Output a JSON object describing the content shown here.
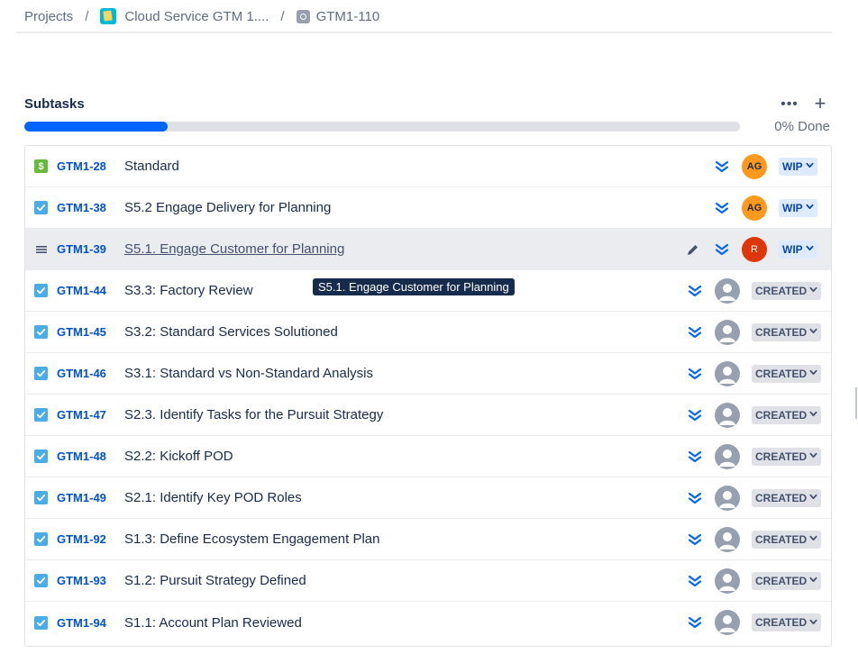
{
  "breadcrumb": {
    "projects": "Projects",
    "project": "Cloud Service GTM 1....",
    "issue": "GTM1-110"
  },
  "subtasks": {
    "title": "Subtasks",
    "progress_percent": 20,
    "done_label": "0% Done",
    "more_icon": "more-icon",
    "add_icon": "plus-icon"
  },
  "tooltip": "S5.1. Engage Customer for Planning",
  "rows": [
    {
      "type": "money",
      "key": "GTM1-28",
      "summary": "Standard",
      "avatar": "AG",
      "status": "WIP"
    },
    {
      "type": "task",
      "key": "GTM1-38",
      "summary": "S5.2 Engage Delivery for Planning",
      "avatar": "AG",
      "status": "WIP"
    },
    {
      "type": "menu",
      "key": "GTM1-39",
      "summary": "S5.1. Engage Customer for Planning",
      "avatar": "R",
      "status": "WIP"
    },
    {
      "type": "task",
      "key": "GTM1-44",
      "summary": "S3.3: Factory Review",
      "avatar": "",
      "status": "CREATED"
    },
    {
      "type": "task",
      "key": "GTM1-45",
      "summary": "S3.2: Standard Services Solutioned",
      "avatar": "",
      "status": "CREATED"
    },
    {
      "type": "task",
      "key": "GTM1-46",
      "summary": "S3.1: Standard vs Non-Standard Analysis",
      "avatar": "",
      "status": "CREATED"
    },
    {
      "type": "task",
      "key": "GTM1-47",
      "summary": "S2.3. Identify Tasks for the Pursuit Strategy",
      "avatar": "",
      "status": "CREATED"
    },
    {
      "type": "task",
      "key": "GTM1-48",
      "summary": "S2.2: Kickoff POD",
      "avatar": "",
      "status": "CREATED"
    },
    {
      "type": "task",
      "key": "GTM1-49",
      "summary": "S2.1: Identify Key POD Roles",
      "avatar": "",
      "status": "CREATED"
    },
    {
      "type": "task",
      "key": "GTM1-92",
      "summary": "S1.3: Define Ecosystem Engagement Plan",
      "avatar": "",
      "status": "CREATED"
    },
    {
      "type": "task",
      "key": "GTM1-93",
      "summary": "S1.2: Pursuit Strategy Defined",
      "avatar": "",
      "status": "CREATED"
    },
    {
      "type": "task",
      "key": "GTM1-94",
      "summary": "S1.1: Account Plan Reviewed",
      "avatar": "",
      "status": "CREATED"
    }
  ],
  "colors": {
    "accent": "#0052cc",
    "progress": "#0065ff",
    "priority": "#0065ff"
  }
}
